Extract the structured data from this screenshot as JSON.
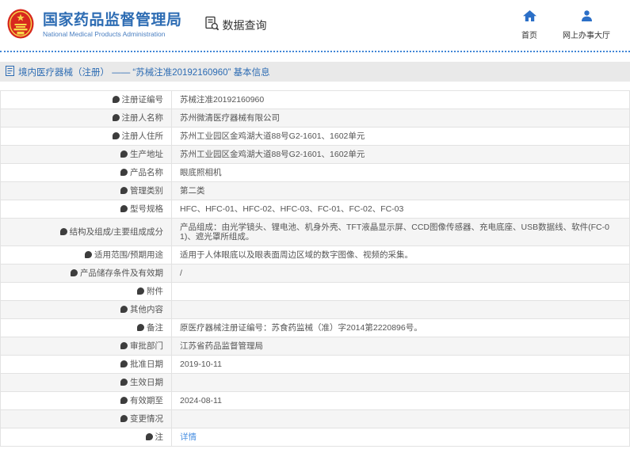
{
  "header": {
    "org_name_cn": "国家药品监督管理局",
    "org_name_en": "National Medical Products Administration",
    "section_title": "数据查询",
    "nav_home": "首页",
    "nav_service_hall": "网上办事大厅"
  },
  "breadcrumb": {
    "text": "境内医疗器械（注册） —— “苏械注准20192160960” 基本信息"
  },
  "colors": {
    "brand_blue": "#2d6cb3",
    "icon_blue": "#2b6fc7",
    "link_blue": "#4a90e2",
    "emblem_red": "#d7281e",
    "emblem_yellow": "#f7d64a",
    "breadcrumb_bg": "#e9e9e9",
    "row_stripe": "#f5f5f5",
    "header_dotted_line": "#4186d6"
  },
  "table": {
    "rows": [
      {
        "label": "注册证编号",
        "value": "苏械注准20192160960"
      },
      {
        "label": "注册人名称",
        "value": "苏州微清医疗器械有限公司"
      },
      {
        "label": "注册人住所",
        "value": "苏州工业园区金鸡湖大道88号G2-1601、1602单元"
      },
      {
        "label": "生产地址",
        "value": "苏州工业园区金鸡湖大道88号G2-1601、1602单元"
      },
      {
        "label": "产品名称",
        "value": "眼底照相机"
      },
      {
        "label": "管理类别",
        "value": "第二类"
      },
      {
        "label": "型号规格",
        "value": "HFC、HFC-01、HFC-02、HFC-03、FC-01、FC-02、FC-03"
      },
      {
        "label": "结构及组成/主要组成成分",
        "value": "产品组成：由光学镜头、锂电池、机身外壳、TFT液晶显示屏、CCD图像传感器、充电底座、USB数据线、软件(FC-01)、遮光罩所组成。"
      },
      {
        "label": "适用范围/预期用途",
        "value": "适用于人体眼底以及眼表面周边区域的数字图像、视频的采集。"
      },
      {
        "label": "产品储存条件及有效期",
        "value": "/"
      },
      {
        "label": "附件",
        "value": ""
      },
      {
        "label": "其他内容",
        "value": ""
      },
      {
        "label": "备注",
        "value": "原医疗器械注册证编号：苏食药监械（准）字2014第2220896号。"
      },
      {
        "label": "审批部门",
        "value": "江苏省药品监督管理局"
      },
      {
        "label": "批准日期",
        "value": "2019-10-11"
      },
      {
        "label": "生效日期",
        "value": ""
      },
      {
        "label": "有效期至",
        "value": "2024-08-11"
      },
      {
        "label": "变更情况",
        "value": ""
      },
      {
        "label": "注",
        "value": "详情",
        "link": true,
        "label_icon": "note-icon"
      }
    ]
  }
}
